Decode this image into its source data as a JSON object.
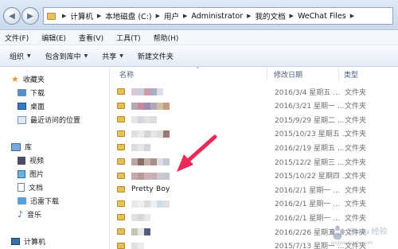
{
  "address_bar": {
    "crumbs": [
      "计算机",
      "本地磁盘 (C:)",
      "用户",
      "Administrator",
      "我的文档",
      "WeChat Files"
    ]
  },
  "menu": [
    "文件(F)",
    "编辑(E)",
    "查看(V)",
    "工具(T)",
    "帮助(H)"
  ],
  "toolbar": {
    "organize": "组织",
    "include_library": "包含到库中",
    "share": "共享",
    "new_folder": "新建文件夹"
  },
  "sidebar": {
    "favorites": "收藏夹",
    "downloads": "下载",
    "desktop": "桌面",
    "recent": "最近访问的位置",
    "libraries": "库",
    "videos": "视频",
    "pictures": "图片",
    "documents": "文档",
    "thunder_downloads": "迅雷下载",
    "music": "音乐",
    "computer": "计算机"
  },
  "columns": {
    "name": "名称",
    "modified": "修改日期",
    "type": "类型"
  },
  "files": [
    {
      "name": "",
      "modified": "2016/3/4 星期五 ...",
      "type": "文件夹",
      "blur": [
        "#d8c8d8",
        "#c8d0e0",
        "#cc9aa8",
        "#a8b0c8",
        "#d9dde6"
      ]
    },
    {
      "name": "",
      "modified": "2016/3/21 星期一 ...",
      "type": "文件夹",
      "blur": [
        "#b8a8b8",
        "#c88aa0",
        "#9c8cb0",
        "#b0a8b8",
        "#d0c0a0",
        "#c89a80"
      ]
    },
    {
      "name": "",
      "modified": "2015/9/29 星期二 ...",
      "type": "文件夹",
      "blur": [
        "#e8e4e8",
        "#d6d6e0",
        "#e4e0e0",
        "#dcdcdc"
      ]
    },
    {
      "name": "",
      "modified": "2015/10/23 星期五 ...",
      "type": "文件夹",
      "blur": [
        "#e0e0e0",
        "#eaeaea",
        "#d8d4d4",
        "#e6e6e6",
        "#dcdcdc",
        "#9a7878"
      ]
    },
    {
      "name": "",
      "modified": "2016/2/19 星期五 ...",
      "type": "文件夹",
      "blur": [
        "#dcdcdc",
        "#e6e6e6",
        "#d4d4dc"
      ]
    },
    {
      "name": "",
      "modified": "2015/12/2 星期三 ...",
      "type": "文件夹",
      "blur": [
        "#b8a8a0",
        "#8c6c64",
        "#c0b0a8",
        "#a89088",
        "#d8dde6",
        "#c4c8d0"
      ]
    },
    {
      "name": "",
      "modified": "2015/10/22 星期四 ...",
      "type": "文件夹",
      "blur": [
        "#c8a8a8",
        "#b89898",
        "#d0b0b0",
        "#c8b0b8",
        "#d0c8d0",
        "#c0c8d8"
      ]
    },
    {
      "name": "Pretty    Boy",
      "modified": "2016/2/1 星期一 ...",
      "type": "文件夹",
      "blur": []
    },
    {
      "name": "",
      "modified": "2016/2/1 星期一 ...",
      "type": "文件夹",
      "blur": [
        "#e8e8e8",
        "#f0f0f0",
        "#dcdcdc",
        "#e8f0f8",
        "#d0dce8",
        "#e0e0e0"
      ]
    },
    {
      "name": "",
      "modified": "2016/2/1 星期一 ...",
      "type": "文件夹",
      "blur": [
        "#e0e0e0",
        "#d8d8d8",
        "#e8e8e8"
      ]
    },
    {
      "name": "",
      "modified": "2016/2/26 星期五 ...",
      "type": "文件夹",
      "blur": [
        "#c0c8b0",
        "#e8e8e8",
        "#5a5a80"
      ]
    },
    {
      "name": "",
      "modified": "2015/7/13 星期一 ...",
      "type": "文件夹",
      "blur": [
        "#e0e0e0",
        "#ececec"
      ]
    }
  ],
  "watermark": "Baidu 经验",
  "watermark_url": "jingyan.baidu.com",
  "colors": {
    "arrow": "#ec2a5a",
    "folder": "#e6bf56"
  }
}
